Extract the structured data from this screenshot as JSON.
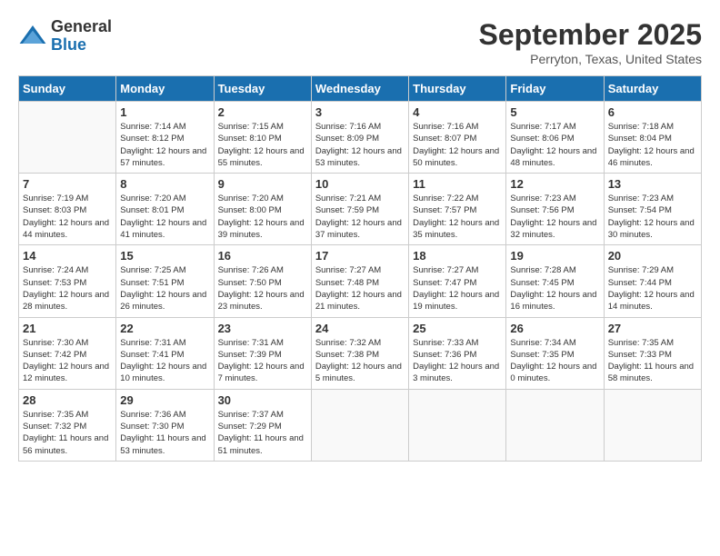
{
  "header": {
    "logo": {
      "line1": "General",
      "line2": "Blue"
    },
    "title": "September 2025",
    "location": "Perryton, Texas, United States"
  },
  "calendar": {
    "days_of_week": [
      "Sunday",
      "Monday",
      "Tuesday",
      "Wednesday",
      "Thursday",
      "Friday",
      "Saturday"
    ],
    "weeks": [
      [
        {
          "day": null,
          "sunrise": null,
          "sunset": null,
          "daylight": null
        },
        {
          "day": "1",
          "sunrise": "Sunrise: 7:14 AM",
          "sunset": "Sunset: 8:12 PM",
          "daylight": "Daylight: 12 hours and 57 minutes."
        },
        {
          "day": "2",
          "sunrise": "Sunrise: 7:15 AM",
          "sunset": "Sunset: 8:10 PM",
          "daylight": "Daylight: 12 hours and 55 minutes."
        },
        {
          "day": "3",
          "sunrise": "Sunrise: 7:16 AM",
          "sunset": "Sunset: 8:09 PM",
          "daylight": "Daylight: 12 hours and 53 minutes."
        },
        {
          "day": "4",
          "sunrise": "Sunrise: 7:16 AM",
          "sunset": "Sunset: 8:07 PM",
          "daylight": "Daylight: 12 hours and 50 minutes."
        },
        {
          "day": "5",
          "sunrise": "Sunrise: 7:17 AM",
          "sunset": "Sunset: 8:06 PM",
          "daylight": "Daylight: 12 hours and 48 minutes."
        },
        {
          "day": "6",
          "sunrise": "Sunrise: 7:18 AM",
          "sunset": "Sunset: 8:04 PM",
          "daylight": "Daylight: 12 hours and 46 minutes."
        }
      ],
      [
        {
          "day": "7",
          "sunrise": "Sunrise: 7:19 AM",
          "sunset": "Sunset: 8:03 PM",
          "daylight": "Daylight: 12 hours and 44 minutes."
        },
        {
          "day": "8",
          "sunrise": "Sunrise: 7:20 AM",
          "sunset": "Sunset: 8:01 PM",
          "daylight": "Daylight: 12 hours and 41 minutes."
        },
        {
          "day": "9",
          "sunrise": "Sunrise: 7:20 AM",
          "sunset": "Sunset: 8:00 PM",
          "daylight": "Daylight: 12 hours and 39 minutes."
        },
        {
          "day": "10",
          "sunrise": "Sunrise: 7:21 AM",
          "sunset": "Sunset: 7:59 PM",
          "daylight": "Daylight: 12 hours and 37 minutes."
        },
        {
          "day": "11",
          "sunrise": "Sunrise: 7:22 AM",
          "sunset": "Sunset: 7:57 PM",
          "daylight": "Daylight: 12 hours and 35 minutes."
        },
        {
          "day": "12",
          "sunrise": "Sunrise: 7:23 AM",
          "sunset": "Sunset: 7:56 PM",
          "daylight": "Daylight: 12 hours and 32 minutes."
        },
        {
          "day": "13",
          "sunrise": "Sunrise: 7:23 AM",
          "sunset": "Sunset: 7:54 PM",
          "daylight": "Daylight: 12 hours and 30 minutes."
        }
      ],
      [
        {
          "day": "14",
          "sunrise": "Sunrise: 7:24 AM",
          "sunset": "Sunset: 7:53 PM",
          "daylight": "Daylight: 12 hours and 28 minutes."
        },
        {
          "day": "15",
          "sunrise": "Sunrise: 7:25 AM",
          "sunset": "Sunset: 7:51 PM",
          "daylight": "Daylight: 12 hours and 26 minutes."
        },
        {
          "day": "16",
          "sunrise": "Sunrise: 7:26 AM",
          "sunset": "Sunset: 7:50 PM",
          "daylight": "Daylight: 12 hours and 23 minutes."
        },
        {
          "day": "17",
          "sunrise": "Sunrise: 7:27 AM",
          "sunset": "Sunset: 7:48 PM",
          "daylight": "Daylight: 12 hours and 21 minutes."
        },
        {
          "day": "18",
          "sunrise": "Sunrise: 7:27 AM",
          "sunset": "Sunset: 7:47 PM",
          "daylight": "Daylight: 12 hours and 19 minutes."
        },
        {
          "day": "19",
          "sunrise": "Sunrise: 7:28 AM",
          "sunset": "Sunset: 7:45 PM",
          "daylight": "Daylight: 12 hours and 16 minutes."
        },
        {
          "day": "20",
          "sunrise": "Sunrise: 7:29 AM",
          "sunset": "Sunset: 7:44 PM",
          "daylight": "Daylight: 12 hours and 14 minutes."
        }
      ],
      [
        {
          "day": "21",
          "sunrise": "Sunrise: 7:30 AM",
          "sunset": "Sunset: 7:42 PM",
          "daylight": "Daylight: 12 hours and 12 minutes."
        },
        {
          "day": "22",
          "sunrise": "Sunrise: 7:31 AM",
          "sunset": "Sunset: 7:41 PM",
          "daylight": "Daylight: 12 hours and 10 minutes."
        },
        {
          "day": "23",
          "sunrise": "Sunrise: 7:31 AM",
          "sunset": "Sunset: 7:39 PM",
          "daylight": "Daylight: 12 hours and 7 minutes."
        },
        {
          "day": "24",
          "sunrise": "Sunrise: 7:32 AM",
          "sunset": "Sunset: 7:38 PM",
          "daylight": "Daylight: 12 hours and 5 minutes."
        },
        {
          "day": "25",
          "sunrise": "Sunrise: 7:33 AM",
          "sunset": "Sunset: 7:36 PM",
          "daylight": "Daylight: 12 hours and 3 minutes."
        },
        {
          "day": "26",
          "sunrise": "Sunrise: 7:34 AM",
          "sunset": "Sunset: 7:35 PM",
          "daylight": "Daylight: 12 hours and 0 minutes."
        },
        {
          "day": "27",
          "sunrise": "Sunrise: 7:35 AM",
          "sunset": "Sunset: 7:33 PM",
          "daylight": "Daylight: 11 hours and 58 minutes."
        }
      ],
      [
        {
          "day": "28",
          "sunrise": "Sunrise: 7:35 AM",
          "sunset": "Sunset: 7:32 PM",
          "daylight": "Daylight: 11 hours and 56 minutes."
        },
        {
          "day": "29",
          "sunrise": "Sunrise: 7:36 AM",
          "sunset": "Sunset: 7:30 PM",
          "daylight": "Daylight: 11 hours and 53 minutes."
        },
        {
          "day": "30",
          "sunrise": "Sunrise: 7:37 AM",
          "sunset": "Sunset: 7:29 PM",
          "daylight": "Daylight: 11 hours and 51 minutes."
        },
        {
          "day": null,
          "sunrise": null,
          "sunset": null,
          "daylight": null
        },
        {
          "day": null,
          "sunrise": null,
          "sunset": null,
          "daylight": null
        },
        {
          "day": null,
          "sunrise": null,
          "sunset": null,
          "daylight": null
        },
        {
          "day": null,
          "sunrise": null,
          "sunset": null,
          "daylight": null
        }
      ]
    ]
  }
}
